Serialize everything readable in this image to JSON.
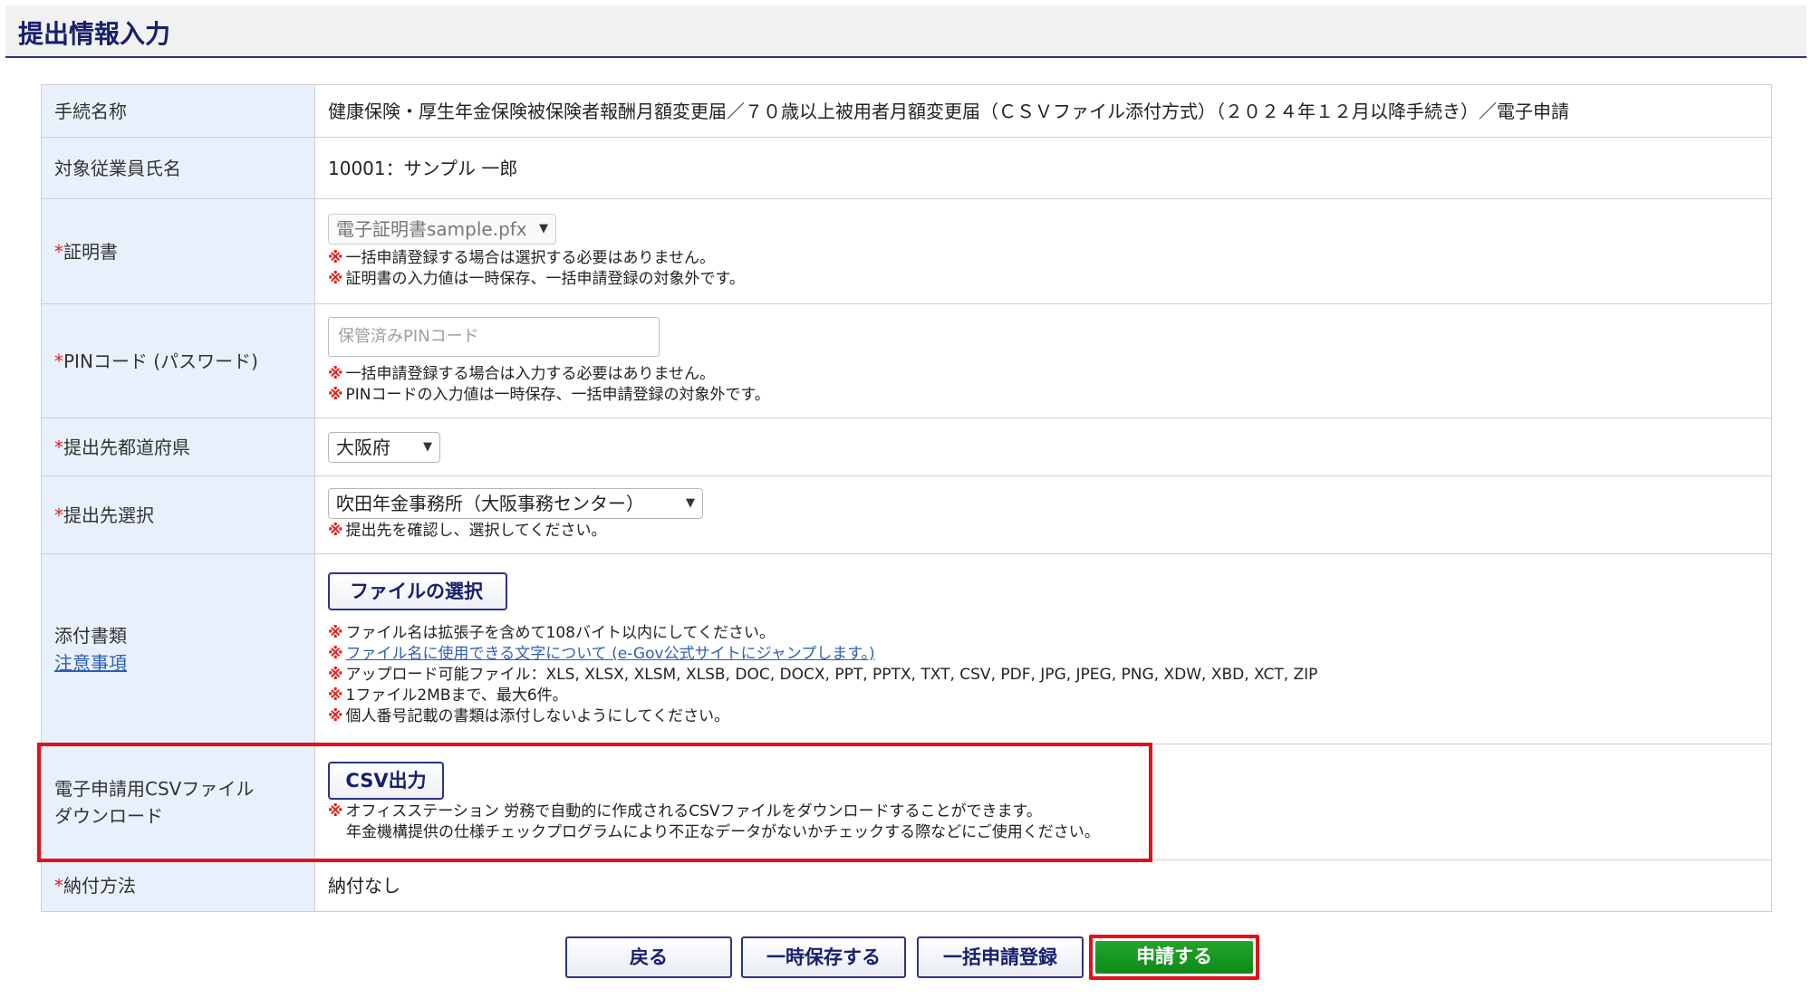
{
  "page": {
    "title": "提出情報入力"
  },
  "rows": {
    "procedure": {
      "label": "手続名称",
      "value": "健康保険・厚生年金保険被保険者報酬月額変更届／７０歳以上被用者月額変更届（ＣＳＶファイル添付方式）（２０２４年１２月以降手続き）／電子申請"
    },
    "employee": {
      "label": "対象従業員氏名",
      "value": "10001：サンプル 一郎"
    },
    "certificate": {
      "required_mark": "*",
      "label": "証明書",
      "selected": "電子証明書sample.pfx",
      "notes": [
        "一括申請登録する場合は選択する必要はありません。",
        "証明書の入力値は一時保存、一括申請登録の対象外です。"
      ]
    },
    "pin": {
      "required_mark": "*",
      "label": "PINコード (パスワード)",
      "placeholder": "保管済みPINコード",
      "notes": [
        "一括申請登録する場合は入力する必要はありません。",
        "PINコードの入力値は一時保存、一括申請登録の対象外です。"
      ]
    },
    "prefecture": {
      "required_mark": "*",
      "label": "提出先都道府県",
      "selected": "大阪府"
    },
    "destination": {
      "required_mark": "*",
      "label": "提出先選択",
      "selected": "吹田年金事務所（大阪事務センター）",
      "notes": [
        "提出先を確認し、選択してください。"
      ]
    },
    "attachments": {
      "label": "添付書類",
      "link_label": "注意事項",
      "file_button": "ファイルの選択",
      "notes": [
        "ファイル名は拡張子を含めて108バイト以内にしてください。",
        "ファイル名に使用できる文字について (e-Gov公式サイトにジャンプします。)",
        "アップロード可能ファイル：XLS, XLSX, XLSM, XLSB, DOC, DOCX, PPT, PPTX, TXT, CSV, PDF, JPG, JPEG, PNG, XDW, XBD, XCT, ZIP",
        "1ファイル2MBまで、最大6件。",
        "個人番号記載の書類は添付しないようにしてください。"
      ]
    },
    "csv": {
      "label_line1": "電子申請用CSVファイル",
      "label_line2": "ダウンロード",
      "button": "CSV出力",
      "note_line1": "オフィスステーション 労務で自動的に作成されるCSVファイルをダウンロードすることができます。",
      "note_line2": "年金機構提供の仕様チェックプログラムにより不正なデータがないかチェックする際などにご使用ください。"
    },
    "payment": {
      "required_mark": "*",
      "label": "納付方法",
      "value": "納付なし"
    }
  },
  "note_mark": "※",
  "actions": {
    "back": "戻る",
    "save": "一時保存する",
    "bulk": "一括申請登録",
    "submit": "申請する"
  },
  "colors": {
    "header_text": "#18206e",
    "required": "#e0201a",
    "highlight": "#e2101a",
    "submit": "#1a9a22",
    "label_bg": "#e8f1fb"
  }
}
